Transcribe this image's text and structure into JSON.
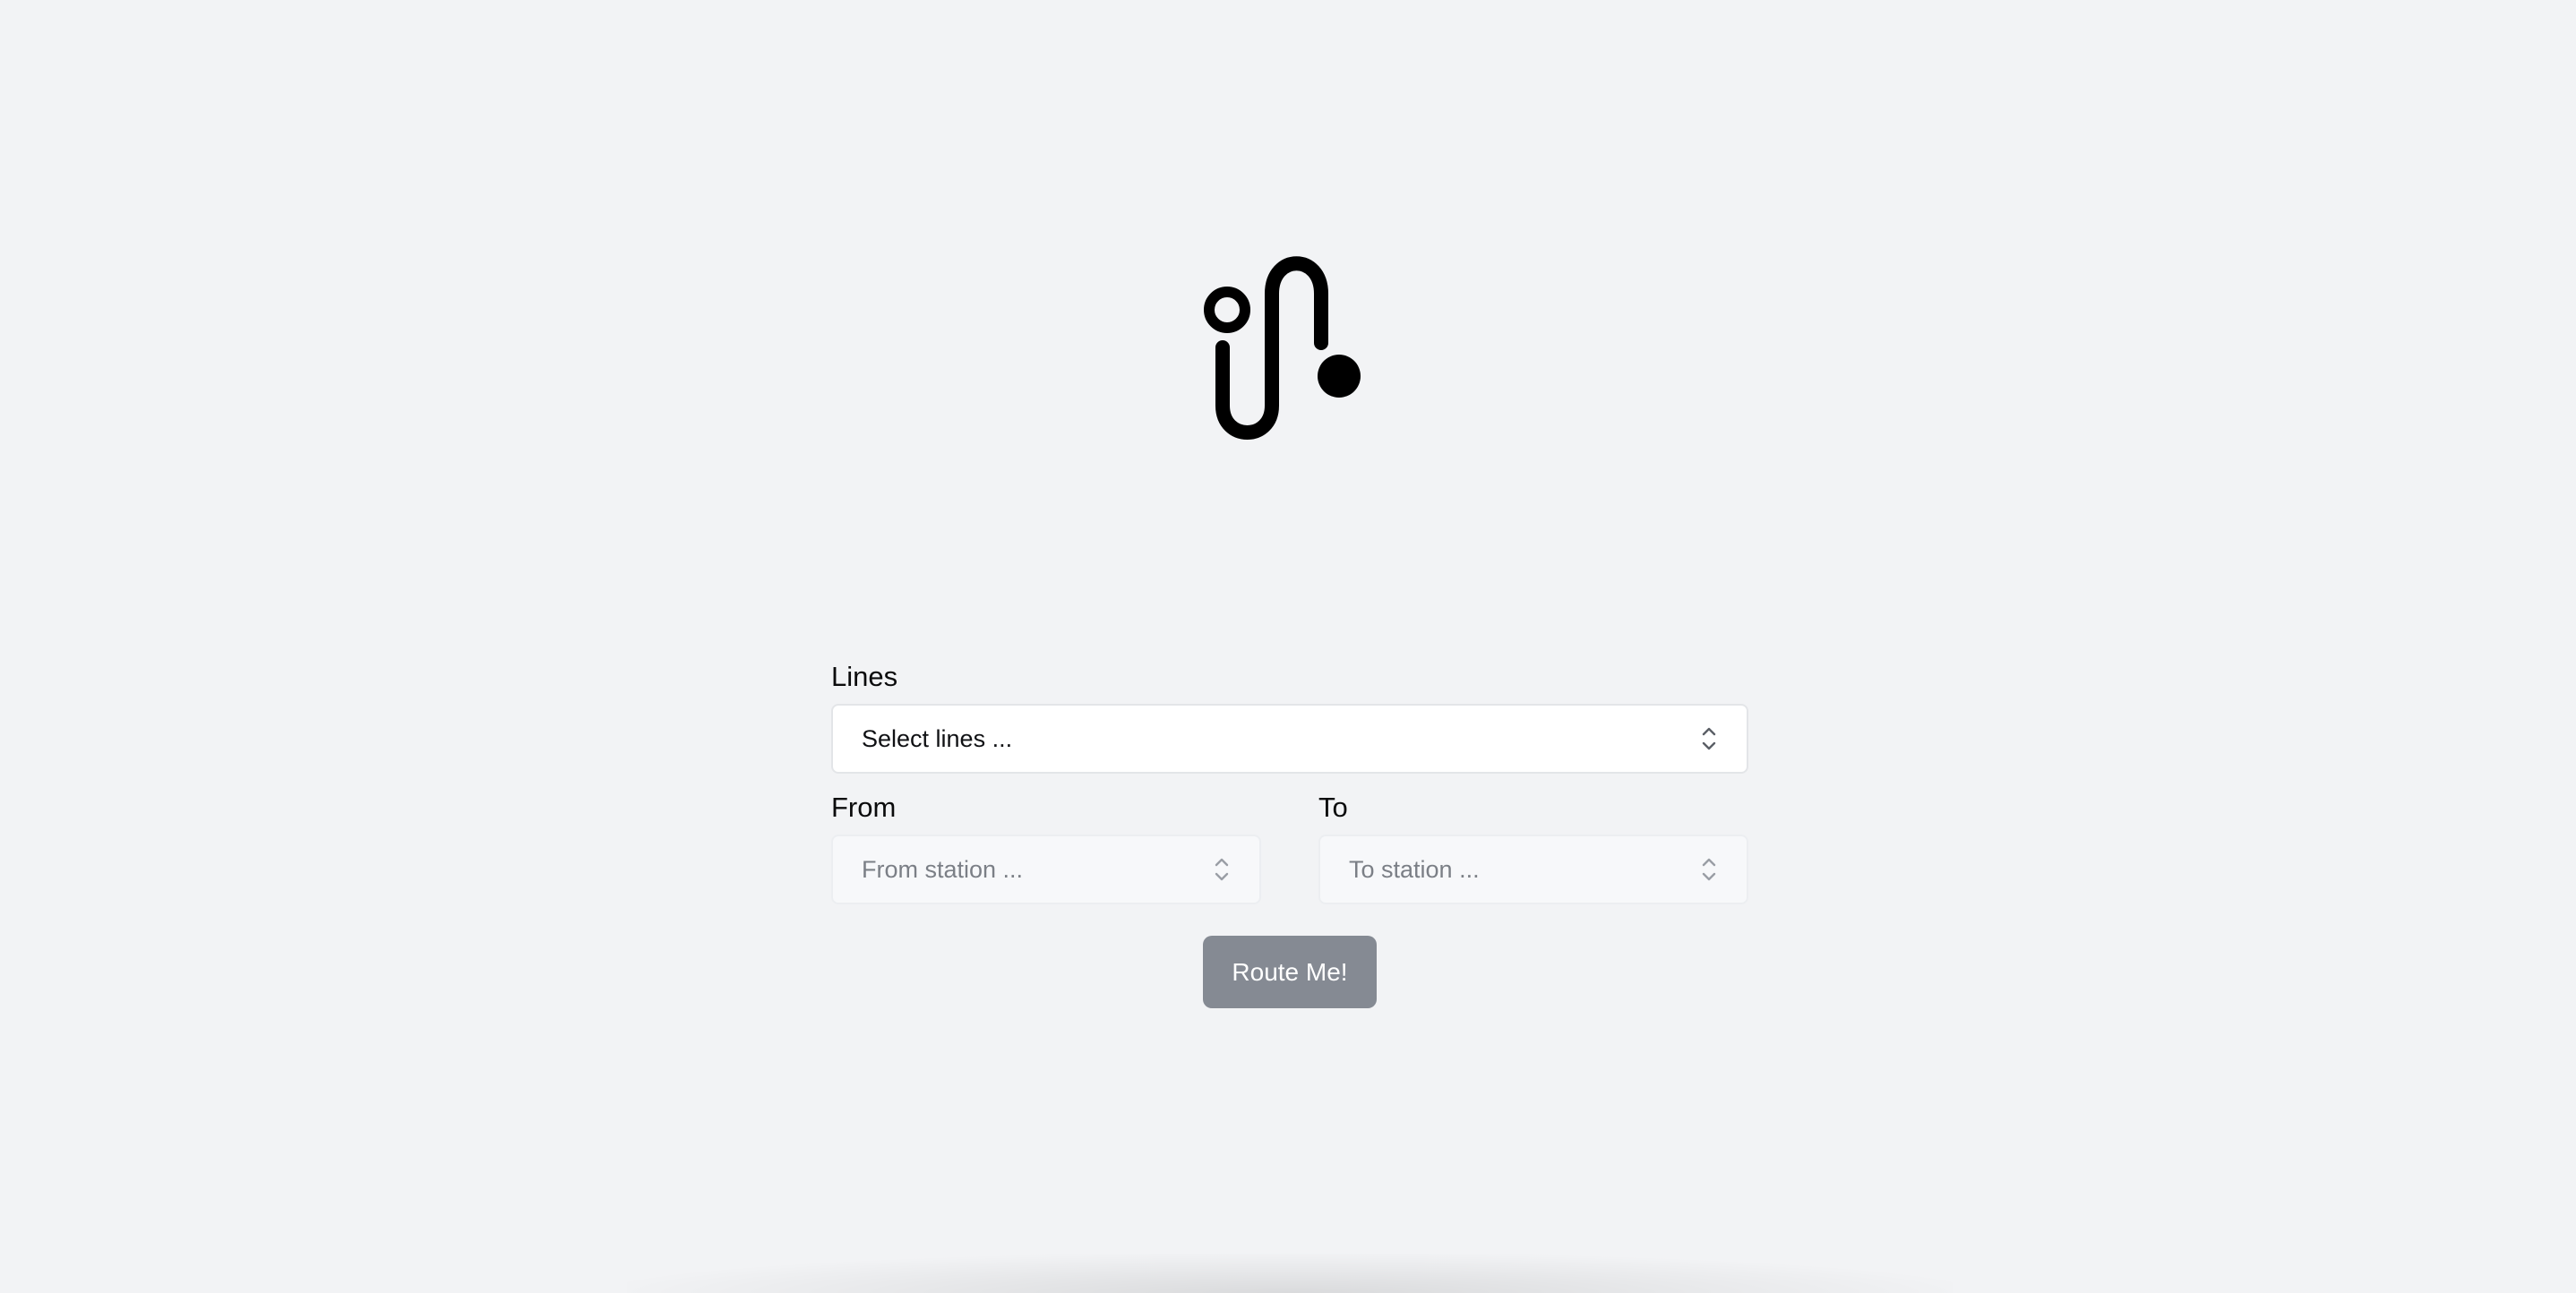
{
  "logo": {
    "icon": "route-logo-icon"
  },
  "form": {
    "lines": {
      "label": "Lines",
      "placeholder": "Select lines ...",
      "icon": "chevron-updown-icon",
      "enabled": true
    },
    "from": {
      "label": "From",
      "placeholder": "From station ...",
      "icon": "chevron-updown-icon",
      "enabled": false
    },
    "to": {
      "label": "To",
      "placeholder": "To station ...",
      "icon": "chevron-updown-icon",
      "enabled": false
    },
    "submit": {
      "label": "Route Me!",
      "enabled": false
    }
  },
  "colors": {
    "background": "#f2f3f5",
    "button_disabled": "#858a93",
    "text": "#0b0b0c",
    "placeholder_disabled": "#7b7f86"
  }
}
